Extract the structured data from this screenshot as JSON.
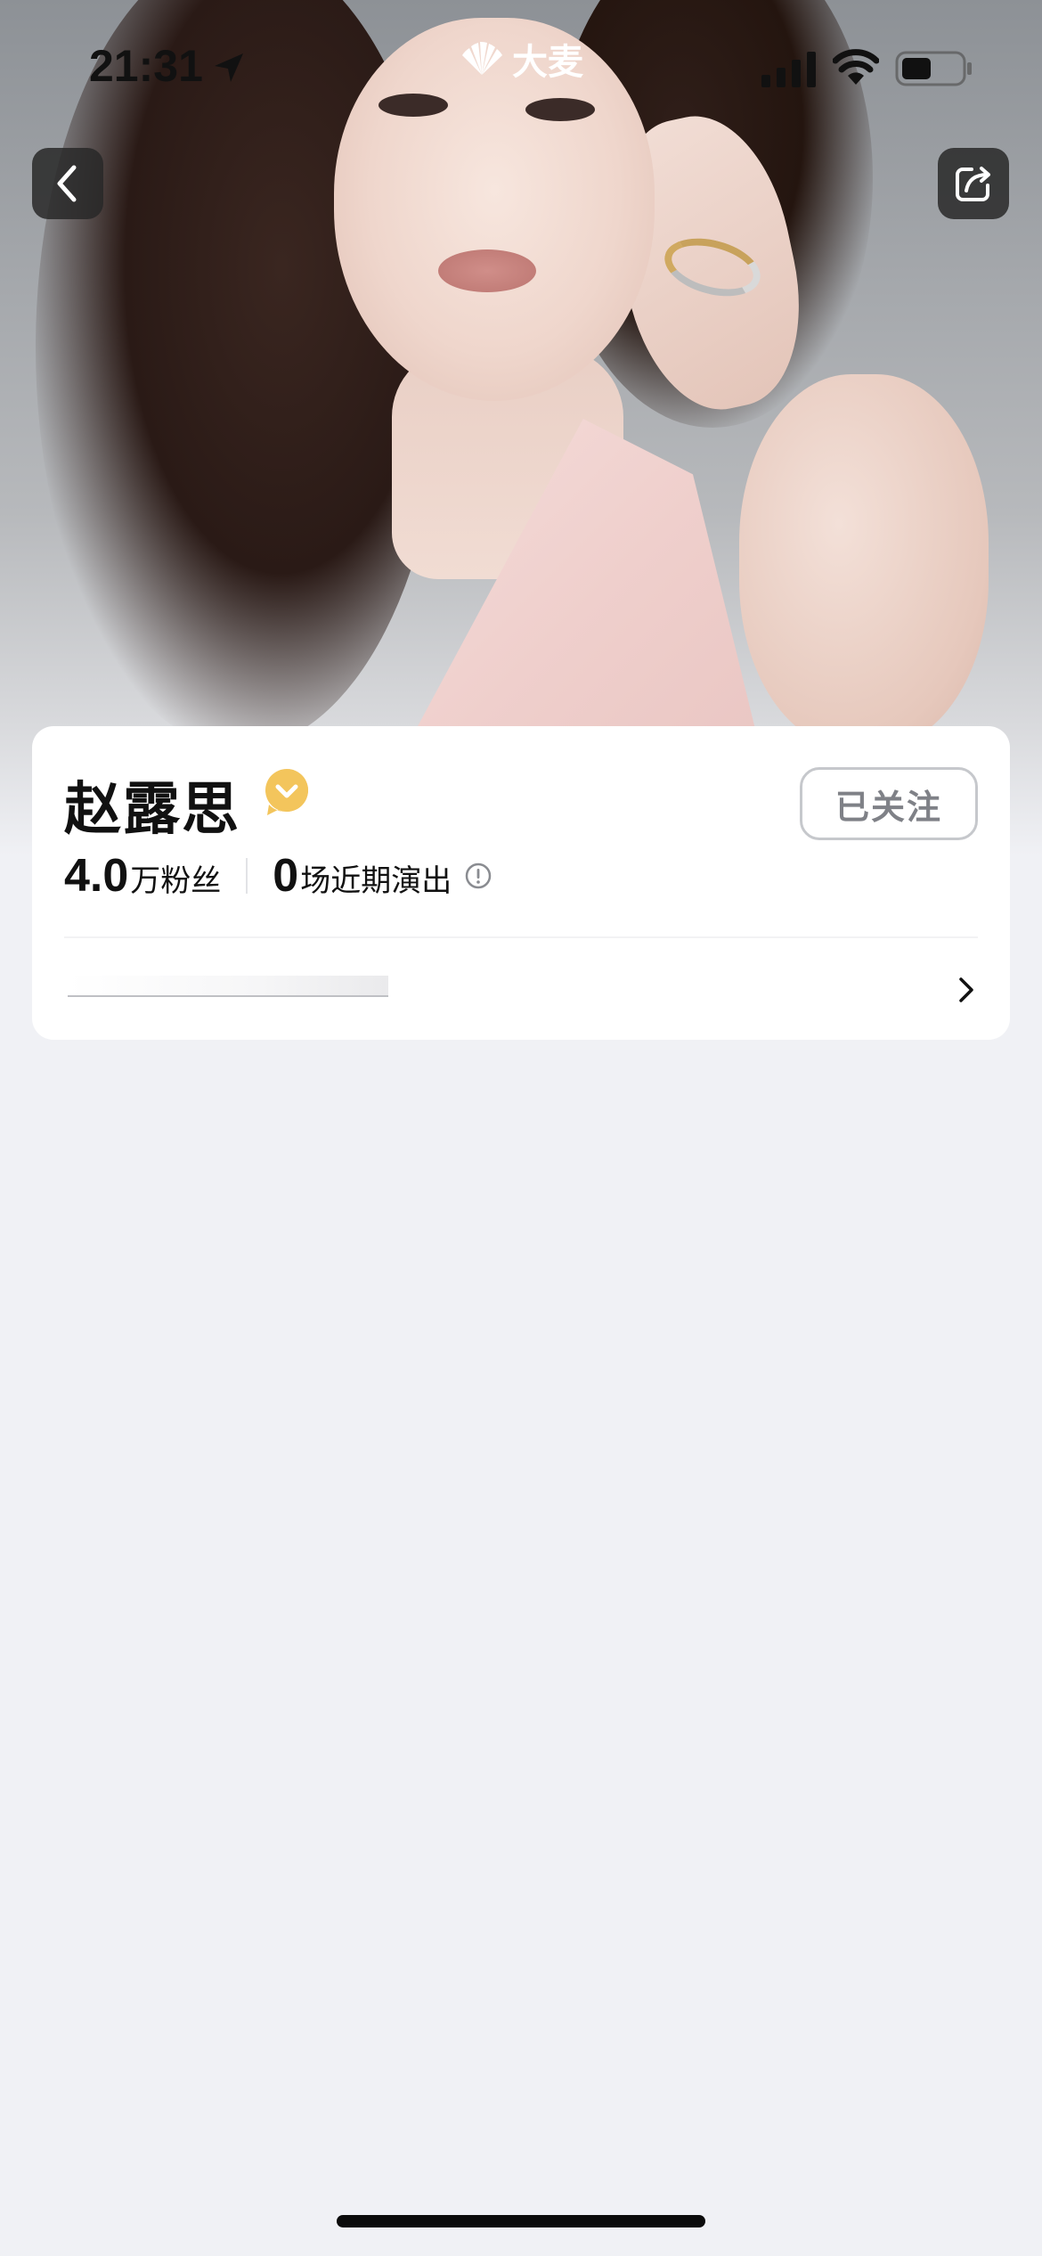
{
  "status_bar": {
    "time": "21:31",
    "app_logo_text": "大麦"
  },
  "nav": {
    "back_icon": "chevron-left-icon",
    "share_icon": "share-icon"
  },
  "artist": {
    "name": "赵露思",
    "verified_icon": "verified-badge-icon",
    "follow_state_label": "已关注",
    "fans_count": "4.0",
    "fans_label": "万粉丝",
    "shows_count": "0",
    "shows_label": "场近期演出"
  },
  "colors": {
    "background": "#f0f1f5",
    "card": "#ffffff",
    "verified_badge": "#f3c55c",
    "follow_border": "#c6c8cc",
    "follow_text": "#7f8187",
    "nav_button_bg": "#282828"
  }
}
